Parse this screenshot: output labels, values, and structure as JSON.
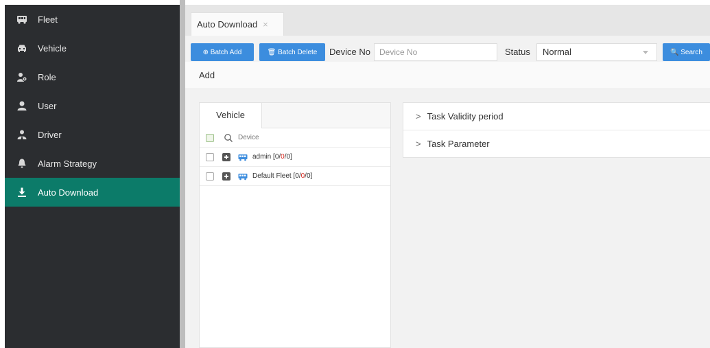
{
  "sidebar": {
    "items": [
      {
        "label": "Fleet",
        "icon": "fleet-icon"
      },
      {
        "label": "Vehicle",
        "icon": "car-icon"
      },
      {
        "label": "Role",
        "icon": "role-icon"
      },
      {
        "label": "User",
        "icon": "user-icon"
      },
      {
        "label": "Driver",
        "icon": "driver-icon"
      },
      {
        "label": "Alarm Strategy",
        "icon": "bell-icon"
      },
      {
        "label": "Auto Download",
        "icon": "download-icon",
        "active": true
      }
    ]
  },
  "tabs": [
    {
      "label": "Auto Download",
      "close": "×"
    }
  ],
  "toolbar": {
    "batch_add": "⊕ Batch Add",
    "batch_delete": "🗑 Batch Delete",
    "device_no_label": "Device No",
    "device_no_placeholder": "Device No",
    "status_label": "Status",
    "status_value": "Normal",
    "search": "🔍 Search"
  },
  "dialog": {
    "title": "Add",
    "tree": {
      "tab": "Vehicle",
      "search_placeholder": "Device",
      "nodes": [
        {
          "name": "admin",
          "counts": [
            "0",
            "0",
            "0"
          ]
        },
        {
          "name": "Default Fleet",
          "counts": [
            "0",
            "0",
            "0"
          ]
        }
      ]
    },
    "sections": [
      "Task Validity period",
      "Task Parameter"
    ]
  },
  "colors": {
    "sidebar_bg": "#2b2d30",
    "active_item": "#0c7b69",
    "button_blue": "#3c8dde",
    "count_red": "#d9261c"
  }
}
